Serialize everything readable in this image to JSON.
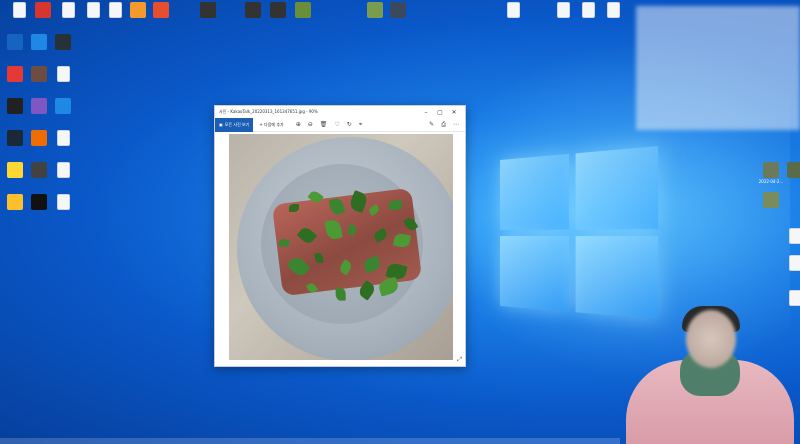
{
  "desktop": {
    "top_icons": [
      {
        "label": "",
        "color": "#f4f6f8"
      },
      {
        "label": "",
        "color": "#d6362e"
      },
      {
        "label": "",
        "color": "#f4f6f8"
      },
      {
        "label": "",
        "color": "#f4f6f8"
      },
      {
        "label": "",
        "color": "#f4f6f8"
      },
      {
        "label": "",
        "color": "#f39a2c"
      },
      {
        "label": "",
        "color": "#e64e2d"
      },
      {
        "label": "",
        "color": "#333333"
      },
      {
        "label": "",
        "color": "#333333"
      },
      {
        "label": "",
        "color": "#333333"
      },
      {
        "label": "",
        "color": "#6b8e3a"
      },
      {
        "label": "",
        "color": "#7a9c4f"
      },
      {
        "label": "",
        "color": "#3a4a5c"
      },
      {
        "label": "",
        "color": "#f4f6f8"
      },
      {
        "label": "",
        "color": "#f4f6f8"
      },
      {
        "label": "",
        "color": "#f4f6f8"
      },
      {
        "label": "",
        "color": "#f4f6f8"
      }
    ],
    "left_icons": [
      {
        "label": "",
        "color": "#1565c0"
      },
      {
        "label": "",
        "color": "#1e88e5"
      },
      {
        "label": "",
        "color": "#263238"
      },
      {
        "label": "",
        "color": "#e53935"
      },
      {
        "label": "",
        "color": "#6d4c41"
      },
      {
        "label": "",
        "color": "#f4f6f8"
      },
      {
        "label": "",
        "color": "#212121"
      },
      {
        "label": "",
        "color": "#7e57c2"
      },
      {
        "label": "",
        "color": "#1e88e5"
      },
      {
        "label": "",
        "color": "#1b2838"
      },
      {
        "label": "",
        "color": "#ef6c00"
      },
      {
        "label": "",
        "color": "#f4f6f8"
      },
      {
        "label": "",
        "color": "#fdd835"
      },
      {
        "label": "",
        "color": "#424242"
      },
      {
        "label": "",
        "color": "#f4f6f8"
      },
      {
        "label": "",
        "color": "#fbc02d"
      },
      {
        "label": "",
        "color": "#111111"
      },
      {
        "label": "",
        "color": "#f4f6f8"
      }
    ],
    "right_icons": [
      {
        "label": "2022-04-2...",
        "color": "#6b7a5a"
      },
      {
        "label": "",
        "color": "#5a6b4a"
      },
      {
        "label": "",
        "color": "#7b8c5c"
      },
      {
        "label": "",
        "color": "#f4f6f8"
      },
      {
        "label": "",
        "color": "#f4f6f8"
      },
      {
        "label": "",
        "color": "#f4f6f8"
      }
    ]
  },
  "viewer": {
    "title": "사진 - KakaoTalk_20220313_161347651.jpg - 90%",
    "minimize": "–",
    "maximize": "▢",
    "close": "✕",
    "primary_action": "모든 사진 보기",
    "add_to": "+ 다음에 추가",
    "tools": [
      "⊕",
      "⊖",
      "🗑",
      "♡",
      "↻",
      "⌖"
    ],
    "right_tools": [
      "✎",
      "⎙",
      "⋯"
    ],
    "resize": "⤢"
  }
}
